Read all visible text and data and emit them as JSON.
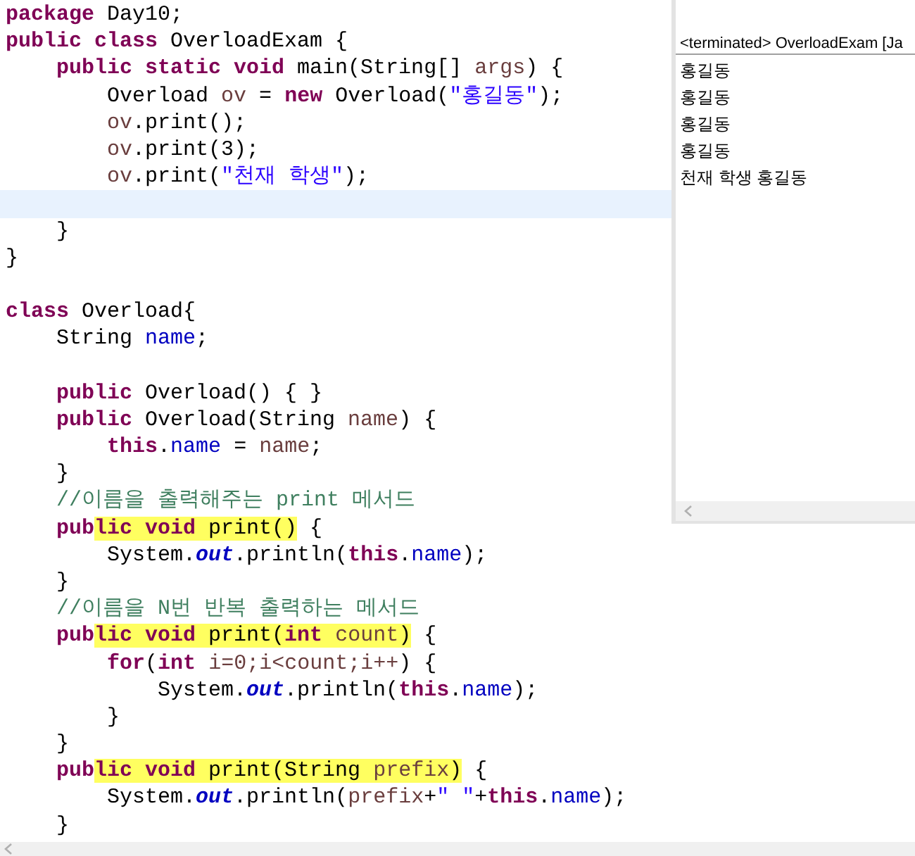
{
  "editor": {
    "lines": [
      {
        "segments": [
          {
            "text": "package",
            "kind": "keyword"
          },
          {
            "text": " Day10;",
            "kind": "plain"
          }
        ]
      },
      {
        "segments": [
          {
            "text": "public class",
            "kind": "keyword"
          },
          {
            "text": " OverloadExam {",
            "kind": "plain"
          }
        ]
      },
      {
        "segments": [
          {
            "text": "    public static void",
            "kind": "keyword"
          },
          {
            "text": " main(String[] ",
            "kind": "plain"
          },
          {
            "text": "args",
            "kind": "local"
          },
          {
            "text": ") {",
            "kind": "plain"
          }
        ]
      },
      {
        "segments": [
          {
            "text": "        Overload ",
            "kind": "plain"
          },
          {
            "text": "ov",
            "kind": "local"
          },
          {
            "text": " = ",
            "kind": "plain"
          },
          {
            "text": "new",
            "kind": "keyword"
          },
          {
            "text": " Overload(",
            "kind": "plain"
          },
          {
            "text": "\"홍길동\"",
            "kind": "string"
          },
          {
            "text": ");",
            "kind": "plain"
          }
        ]
      },
      {
        "segments": [
          {
            "text": "        ov",
            "kind": "local"
          },
          {
            "text": ".print();",
            "kind": "plain"
          }
        ]
      },
      {
        "segments": [
          {
            "text": "        ov",
            "kind": "local"
          },
          {
            "text": ".print(3);",
            "kind": "plain"
          }
        ]
      },
      {
        "segments": [
          {
            "text": "        ov",
            "kind": "local"
          },
          {
            "text": ".print(",
            "kind": "plain"
          },
          {
            "text": "\"천재 학생\"",
            "kind": "string"
          },
          {
            "text": ");",
            "kind": "plain"
          }
        ]
      },
      {
        "current": true
      },
      {
        "segments": [
          {
            "text": "    }",
            "kind": "plain"
          }
        ]
      },
      {
        "segments": [
          {
            "text": "}",
            "kind": "plain"
          }
        ]
      },
      {
        "blank_line_before": true,
        "segments": [
          {
            "text": "class",
            "kind": "keyword"
          },
          {
            "text": " Overload{",
            "kind": "plain"
          }
        ]
      },
      {
        "segments": [
          {
            "text": "    String ",
            "kind": "plain"
          },
          {
            "text": "name",
            "kind": "field"
          },
          {
            "text": ";",
            "kind": "plain"
          }
        ]
      },
      {
        "blank_line_before": true,
        "segments": [
          {
            "text": "    public",
            "kind": "keyword"
          },
          {
            "text": " Overload() { }",
            "kind": "plain"
          }
        ]
      },
      {
        "segments": [
          {
            "text": "    public",
            "kind": "keyword"
          },
          {
            "text": " Overload(String ",
            "kind": "plain"
          },
          {
            "text": "name",
            "kind": "local"
          },
          {
            "text": ") {",
            "kind": "plain"
          }
        ]
      },
      {
        "segments": [
          {
            "text": "        this",
            "kind": "keyword"
          },
          {
            "text": ".",
            "kind": "plain"
          },
          {
            "text": "name",
            "kind": "field"
          },
          {
            "text": " = ",
            "kind": "plain"
          },
          {
            "text": "name",
            "kind": "local"
          },
          {
            "text": ";",
            "kind": "plain"
          }
        ]
      },
      {
        "segments": [
          {
            "text": "    }",
            "kind": "plain"
          }
        ]
      },
      {
        "segments": [
          {
            "text": "    //이름을 출력해주는 print 메서드",
            "kind": "comment"
          }
        ]
      },
      {
        "segments": [
          {
            "text": "    pub",
            "kind": "keyword"
          },
          {
            "text": "lic void",
            "kind": "keyword",
            "marked": true
          },
          {
            "text": " print()",
            "kind": "plain",
            "marked": true
          },
          {
            "text": " {",
            "kind": "plain"
          }
        ]
      },
      {
        "segments": [
          {
            "text": "        System.",
            "kind": "plain"
          },
          {
            "text": "out",
            "kind": "static"
          },
          {
            "text": ".println(",
            "kind": "plain"
          },
          {
            "text": "this",
            "kind": "keyword"
          },
          {
            "text": ".",
            "kind": "plain"
          },
          {
            "text": "name",
            "kind": "field"
          },
          {
            "text": ");",
            "kind": "plain"
          }
        ]
      },
      {
        "segments": [
          {
            "text": "    }",
            "kind": "plain"
          }
        ]
      },
      {
        "segments": [
          {
            "text": "    //이름을 N번 반복 출력하는 메서드",
            "kind": "comment"
          }
        ]
      },
      {
        "segments": [
          {
            "text": "    pub",
            "kind": "keyword"
          },
          {
            "text": "lic void",
            "kind": "keyword",
            "marked": true
          },
          {
            "text": " print(",
            "kind": "plain",
            "marked": true
          },
          {
            "text": "int",
            "kind": "keyword",
            "marked": true
          },
          {
            "text": " count",
            "kind": "local",
            "marked": true
          },
          {
            "text": ")",
            "kind": "plain",
            "marked": true
          },
          {
            "text": " {",
            "kind": "plain"
          }
        ]
      },
      {
        "segments": [
          {
            "text": "        for",
            "kind": "keyword"
          },
          {
            "text": "(",
            "kind": "plain"
          },
          {
            "text": "int",
            "kind": "keyword"
          },
          {
            "text": " i=0;i<count;i++",
            "kind": "local"
          },
          {
            "text": ") {",
            "kind": "plain"
          }
        ]
      },
      {
        "segments": [
          {
            "text": "            System.",
            "kind": "plain"
          },
          {
            "text": "out",
            "kind": "static"
          },
          {
            "text": ".println(",
            "kind": "plain"
          },
          {
            "text": "this",
            "kind": "keyword"
          },
          {
            "text": ".",
            "kind": "plain"
          },
          {
            "text": "name",
            "kind": "field"
          },
          {
            "text": ");",
            "kind": "plain"
          }
        ]
      },
      {
        "segments": [
          {
            "text": "        }",
            "kind": "plain"
          }
        ]
      },
      {
        "segments": [
          {
            "text": "    }",
            "kind": "plain"
          }
        ]
      },
      {
        "segments": [
          {
            "text": "    pub",
            "kind": "keyword"
          },
          {
            "text": "lic void",
            "kind": "keyword",
            "marked": true
          },
          {
            "text": " print(String ",
            "kind": "plain",
            "marked": true
          },
          {
            "text": "prefix",
            "kind": "local",
            "marked": true
          },
          {
            "text": ")",
            "kind": "plain",
            "marked": true
          },
          {
            "text": " {",
            "kind": "plain"
          }
        ]
      },
      {
        "segments": [
          {
            "text": "        System.",
            "kind": "plain"
          },
          {
            "text": "out",
            "kind": "static"
          },
          {
            "text": ".println(",
            "kind": "plain"
          },
          {
            "text": "prefix",
            "kind": "local"
          },
          {
            "text": "+",
            "kind": "plain"
          },
          {
            "text": "\" \"",
            "kind": "string"
          },
          {
            "text": "+",
            "kind": "plain"
          },
          {
            "text": "this",
            "kind": "keyword"
          },
          {
            "text": ".",
            "kind": "plain"
          },
          {
            "text": "name",
            "kind": "field"
          },
          {
            "text": ");",
            "kind": "plain"
          }
        ]
      },
      {
        "segments": [
          {
            "text": "    }",
            "kind": "plain"
          }
        ]
      }
    ]
  },
  "console": {
    "header": "<terminated> OverloadExam [Ja",
    "output": [
      "홍길동",
      "홍길동",
      "홍길동",
      "홍길동",
      "천재 학생 홍길동"
    ]
  }
}
